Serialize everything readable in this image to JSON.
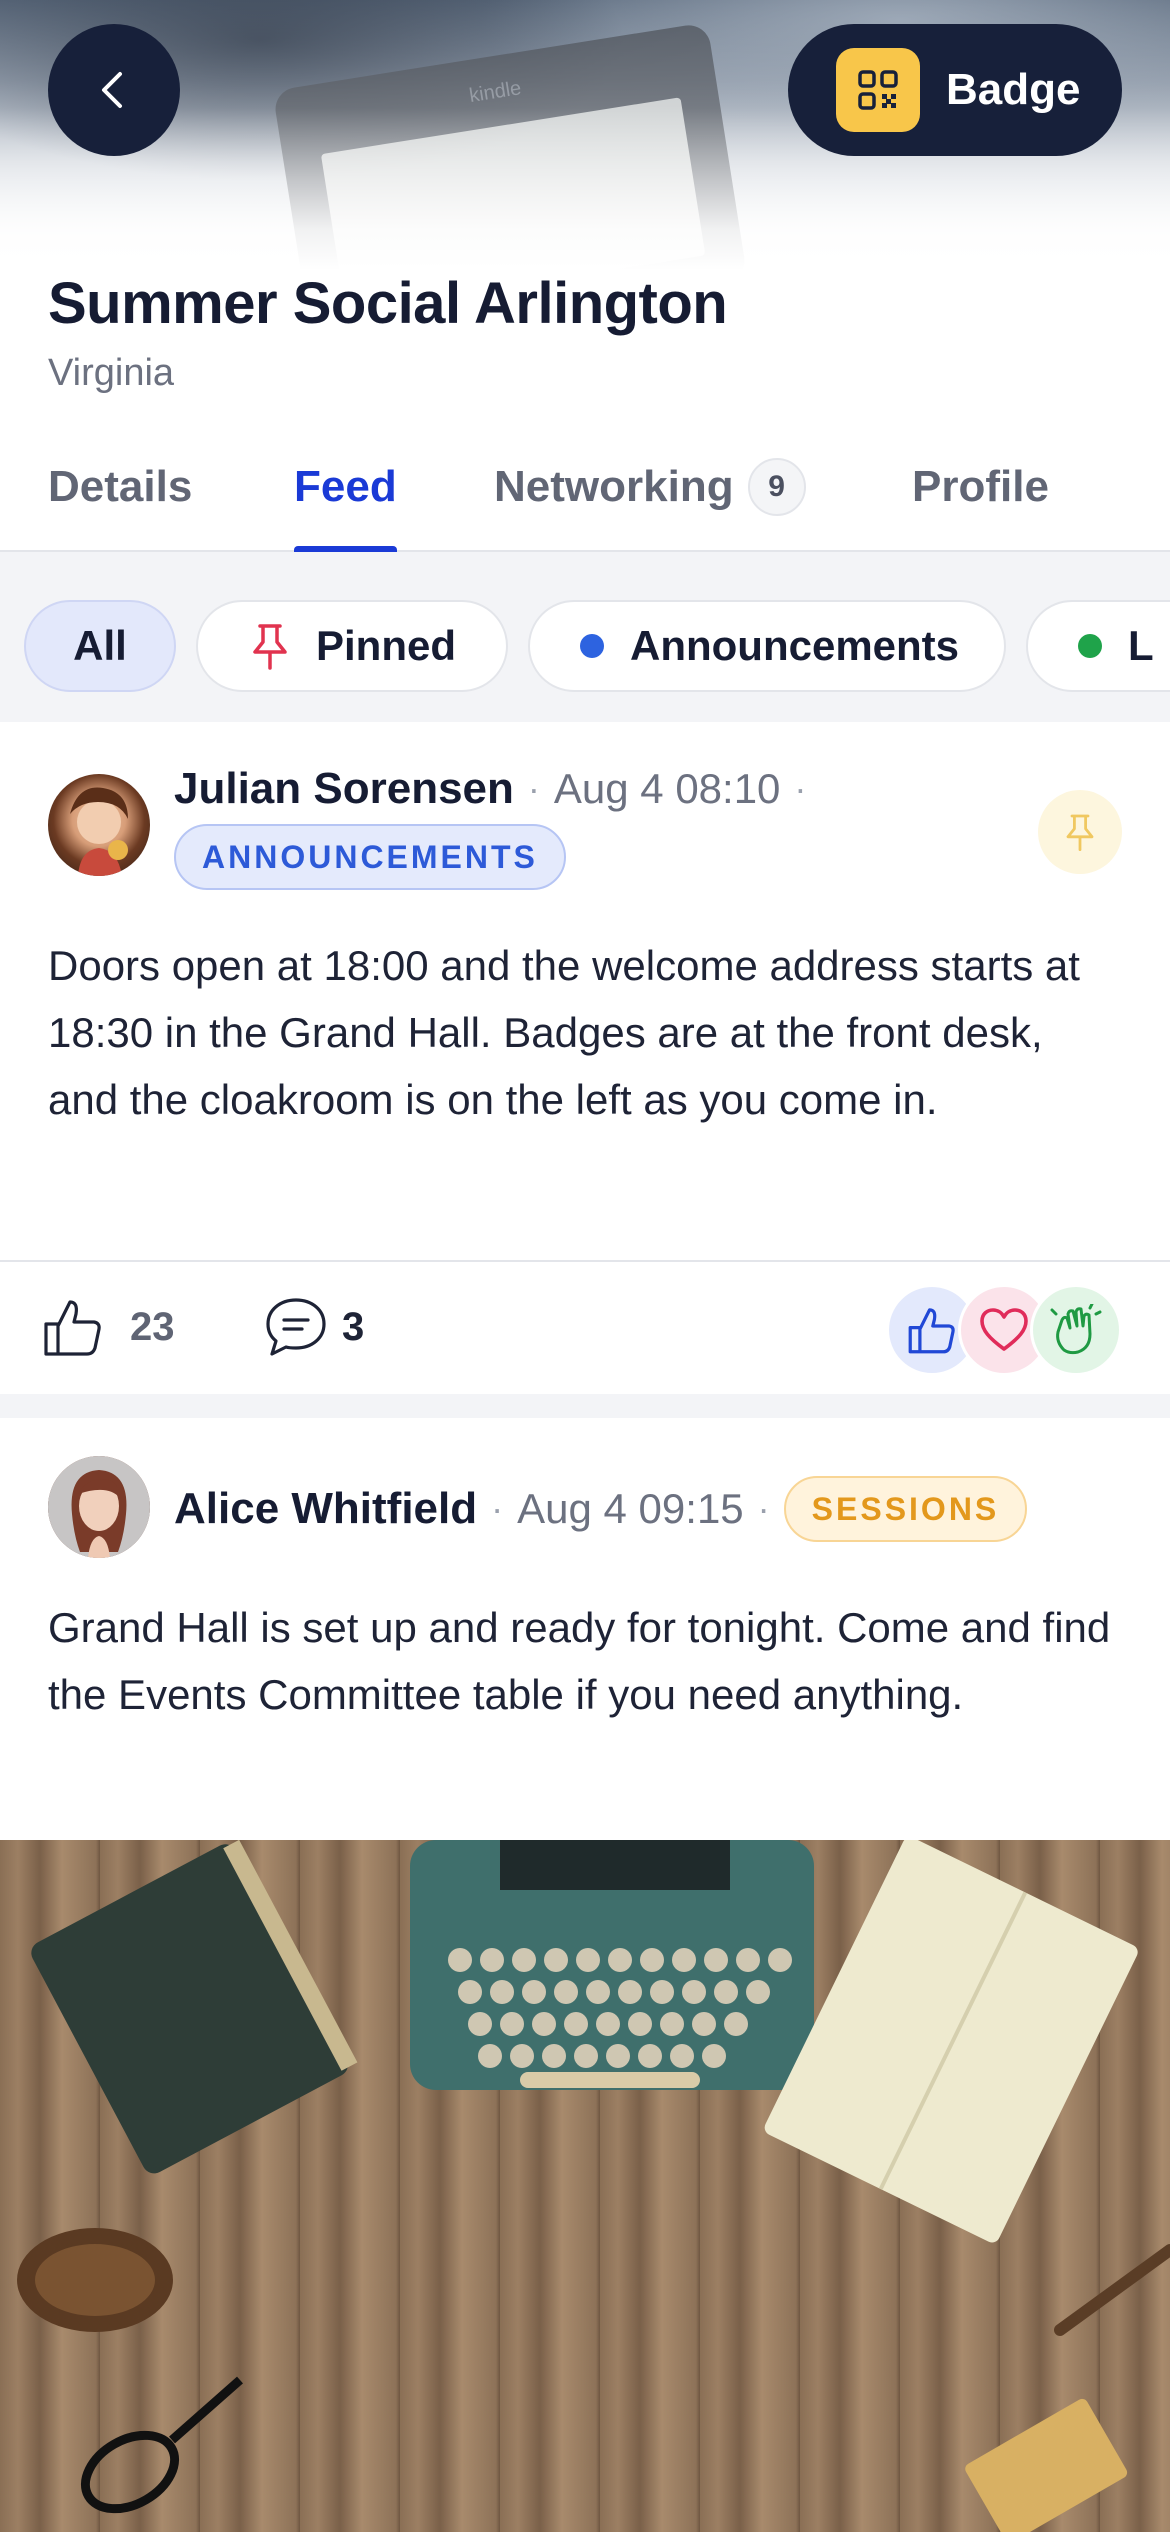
{
  "hero": {
    "image": "event-cover-kindle",
    "badge_label": "Badge",
    "back_icon": "chevron-left-icon",
    "badge_icon": "qr-code-icon",
    "colors": {
      "nav_button": "#17203a",
      "badge_icon_bg": "#f8c64a"
    }
  },
  "event": {
    "title": "Summer Social Arlington",
    "location": "Virginia"
  },
  "tabs": [
    {
      "label": "Details",
      "active": false
    },
    {
      "label": "Feed",
      "active": true
    },
    {
      "label": "Networking",
      "active": false,
      "count": "9"
    },
    {
      "label": "Profile",
      "active": false
    }
  ],
  "filters": [
    {
      "label": "All",
      "active": true
    },
    {
      "label": "Pinned",
      "icon": "pin-icon",
      "icon_color": "#e1334f"
    },
    {
      "label": "Announcements",
      "dot_color": "#2d63e0"
    },
    {
      "label": "L",
      "dot_color": "#1fa34a"
    }
  ],
  "posts": [
    {
      "author": "Julian Sorensen",
      "time": "Aug 4 08:10",
      "tag": "ANNOUNCEMENTS",
      "pinned": true,
      "text": "Doors open at 18:00 and the welcome address starts at 18:30 in the Grand Hall. Badges are at the front desk, and the cloakroom is on the left as you come in.",
      "likes": "23",
      "comments": "3",
      "reactions": [
        "thumbs-up-icon",
        "heart-icon",
        "clap-icon"
      ]
    },
    {
      "author": "Alice Whitfield",
      "time": "Aug 4 09:15",
      "tag": "SESSIONS",
      "text": "Grand Hall is set up and ready for tonight. Come and find the Events Committee table if you need anything.",
      "image": "desk-typewriter-photo"
    }
  ],
  "colors": {
    "accent": "#1a3ad6",
    "announcements_tag": "#2d5ad8",
    "sessions_tag": "#e3981c",
    "pin_highlight": "#fdf6de"
  }
}
